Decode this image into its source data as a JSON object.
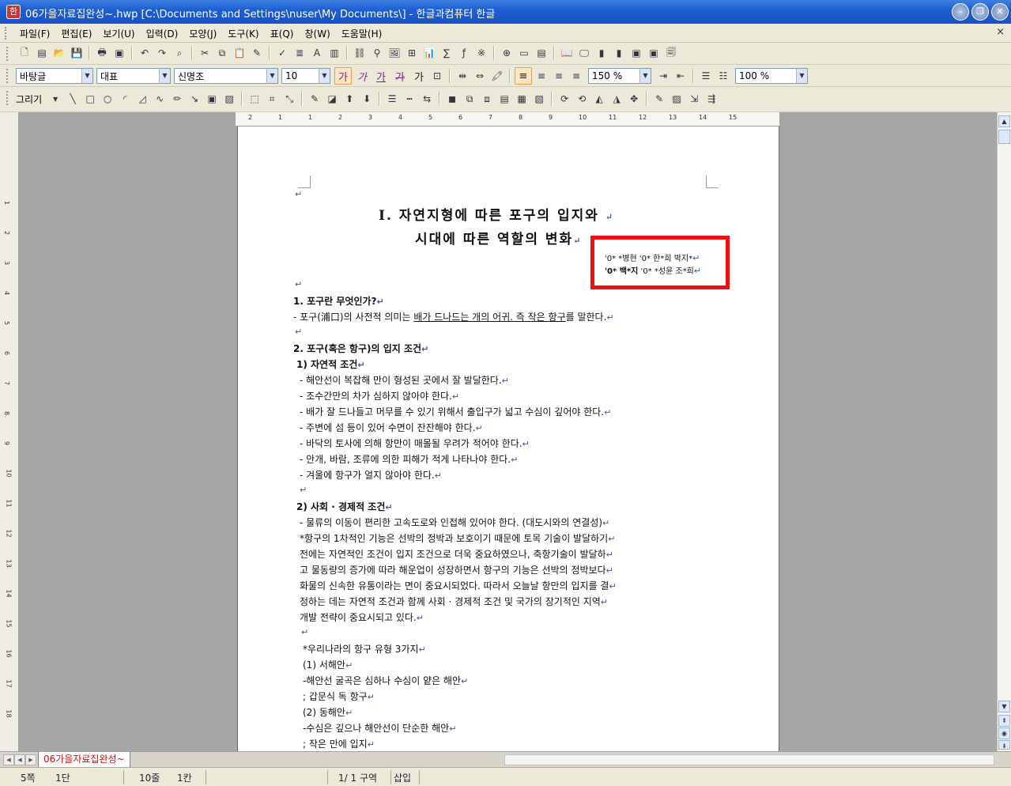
{
  "window": {
    "title": "06가을자료집완성~.hwp [C:\\Documents and Settings\\nuser\\My Documents\\] - 한글과컴퓨터 한글",
    "app_icon": "한",
    "minimize": "–",
    "restore": "❐",
    "close": "✕"
  },
  "menu": {
    "items": [
      "파일(F)",
      "편집(E)",
      "보기(U)",
      "입력(D)",
      "모양(J)",
      "도구(K)",
      "표(Q)",
      "창(W)",
      "도움말(H)"
    ],
    "close": "×"
  },
  "format_bar": {
    "style": "바탕글",
    "font_group": "대표",
    "font_name": "신명조",
    "font_size": "10",
    "zoom_percent": "150 %",
    "view_zoom": "100 %",
    "bold_glyph": "가",
    "italic_glyph": "가",
    "underline_glyph": "가",
    "strike_glyph": "가",
    "color_glyph": "가"
  },
  "draw_bar": {
    "label": "그리기"
  },
  "document": {
    "title_line1": "Ⅰ. 자연지형에 따른 포구의 입지와",
    "title_line2": "시대에 따른 역할의 변화",
    "authors_line1": "'0* *병현 '0* 한*희 박지*",
    "authors_line2a": "'0* 백*지",
    "authors_line2b": " '0* *성윤 조*희",
    "sec1_heading": "1. 포구란 무엇인가?",
    "sec1_text_a": "- 포구(浦口)의 사전적 의미는 ",
    "sec1_text_u": "배가 드나드는 개의 어귀. 즉 작은 항구",
    "sec1_text_b": "를 말한다.",
    "sec2_heading": "2. 포구(혹은 항구)의 입지 조건",
    "sec2_sub1": "1) 자연적 조건",
    "natural_conditions": [
      "- 해안선이 복잡해 만이 형성된 곳에서 잘 발달한다.",
      "- 조수간만의 차가 심하지 않아야 한다.",
      "- 배가 잘 드나들고 머무를 수 있기 위해서 출입구가 넓고 수심이 깊어야 한다.",
      "- 주변에 섬 등이 있어 수면이 잔잔해야 한다.",
      "- 바닥의 토사에 의해 항만이 매몰될 우려가 적어야 한다.",
      "- 안개, 바람, 조류에 의한 피해가 적게 나타나야 한다.",
      "- 겨울에 항구가 얼지 않아야 한다."
    ],
    "sec2_sub2": "2) 사회 · 경제적 조건",
    "social_conditions": [
      "- 물류의 이동이 편리한 고속도로와 인접해 있어야 한다. (대도시와의 연결성)",
      "*항구의 1차적인 기능은 선박의 정박과 보호이기 때문에 토목 기술이 발달하기",
      "전에는 자연적인 조건이 입지 조건으로 더욱 중요하였으나, 축항기술이 발달하",
      "고 물동량의 증가에 따라 해운업이 성장하면서 항구의 기능은 선박의 정박보다",
      "화물의 신속한 유통이라는 면이 중요시되었다. 따라서 오늘날 항만의 입지를 결",
      "정하는 데는 자연적 조건과 함께 사회 · 경제적 조건 및 국가의 장기적인 지역",
      "개발 전략이 중요시되고 있다."
    ],
    "port_types_heading": "*우리나라의 항구 유형 3가지",
    "port_types": [
      "(1) 서해안",
      "-해안선 굴곡은 심하나 수심이 얕은 해안",
      "; 갑문식 독 항구",
      "(2) 동해안",
      "-수심은 깊으나 해안선이 단순한 해안",
      "; 작은 만에 입지"
    ],
    "para_mark": "↵"
  },
  "ruler_numbers": [
    "2",
    "1",
    "1",
    "2",
    "3",
    "4",
    "5",
    "6",
    "7",
    "8",
    "9",
    "10",
    "11",
    "12",
    "13",
    "14",
    "15"
  ],
  "left_ruler_numbers": [
    "1",
    "2",
    "3",
    "4",
    "5",
    "6",
    "7",
    "8",
    "9",
    "10",
    "11",
    "12",
    "13",
    "14",
    "15",
    "16",
    "17",
    "18"
  ],
  "tab": {
    "label": "06가을자료집완성~"
  },
  "status": {
    "page": "5쪽",
    "column": "1단",
    "line": "10줄",
    "col_pos": "1칸",
    "section": "1/  1 구역",
    "mode": "삽입"
  },
  "colors": {
    "highlight_box": "#ee1111",
    "titlebar": "#1e5fd4",
    "tab_text": "#cc1111"
  }
}
